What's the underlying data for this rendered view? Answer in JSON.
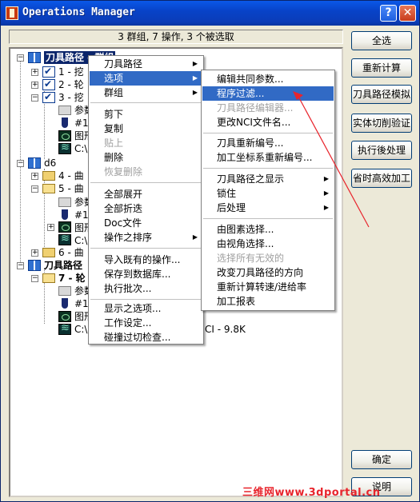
{
  "window": {
    "title": "Operations Manager",
    "help_label": "?",
    "close_label": "✕"
  },
  "status": {
    "text": "3 群组, 7 操作, 3 个被选取"
  },
  "buttons": {
    "select_all": "全选",
    "recalc": "重新计算",
    "backplot": "刀具路径模拟",
    "verify": "实体切削验证",
    "post": "执行後处理",
    "highfeed": "省时高效加工",
    "ok": "确定",
    "help": "说明"
  },
  "tree": {
    "group1": "刀具路径 - 群组",
    "op1": "1 - 挖",
    "op2": "2 - 轮",
    "op3": "3 - 挖",
    "params": "参数",
    "tool": "#1",
    "geom": "图形",
    "nci": "C:\\",
    "group2": "d6",
    "op4": "4 - 曲",
    "op5": "5 - 曲",
    "op6": "6 - 曲",
    "group3": "刀具路径",
    "op7": "7 - 轮",
    "nci_size_suffix": "CI - 9.8K",
    "expander_minus": "−",
    "expander_plus": "+"
  },
  "context_menu": {
    "toolpaths": "刀具路径",
    "options": "选项",
    "groups": "群组",
    "cut": "剪下",
    "copy": "复制",
    "paste": "贴上",
    "delete": "删除",
    "undelete": "恢复删除",
    "expand_all": "全部展开",
    "collapse_all": "全部折迭",
    "doc_file": "Doc文件",
    "sort_ops": "操作之排序",
    "import_ops": "导入既有的操作...",
    "save_to_lib": "保存到数据库...",
    "batch": "执行批次...",
    "display_opts": "显示之选项...",
    "work_setup": "工作设定...",
    "collision": "碰撞过切检查..."
  },
  "submenu": {
    "edit_common": "编辑共同参数...",
    "prog_filter": "程序过滤...",
    "tp_editor": "刀具路径编辑器...",
    "change_nci": "更改NCI文件名...",
    "renumber_tools": "刀具重新编号...",
    "renumber_wcs": "加工坐标系重新编号...",
    "tp_display": "刀具路径之显示",
    "lock": "锁住",
    "post": "后处理",
    "sel_by_geom": "由图素选择...",
    "sel_by_view": "由视角选择...",
    "sel_invalid": "选择所有无效的",
    "change_dir": "改变刀具路径的方向",
    "recalc_feed": "重新计算转速/进给率",
    "report": "加工报表"
  },
  "watermark": "三维网www.3dportal.cn",
  "colors": {
    "title_bar": "#0843c8",
    "menu_highlight": "#316ac5",
    "annotation_arrow": "#e8242c"
  }
}
